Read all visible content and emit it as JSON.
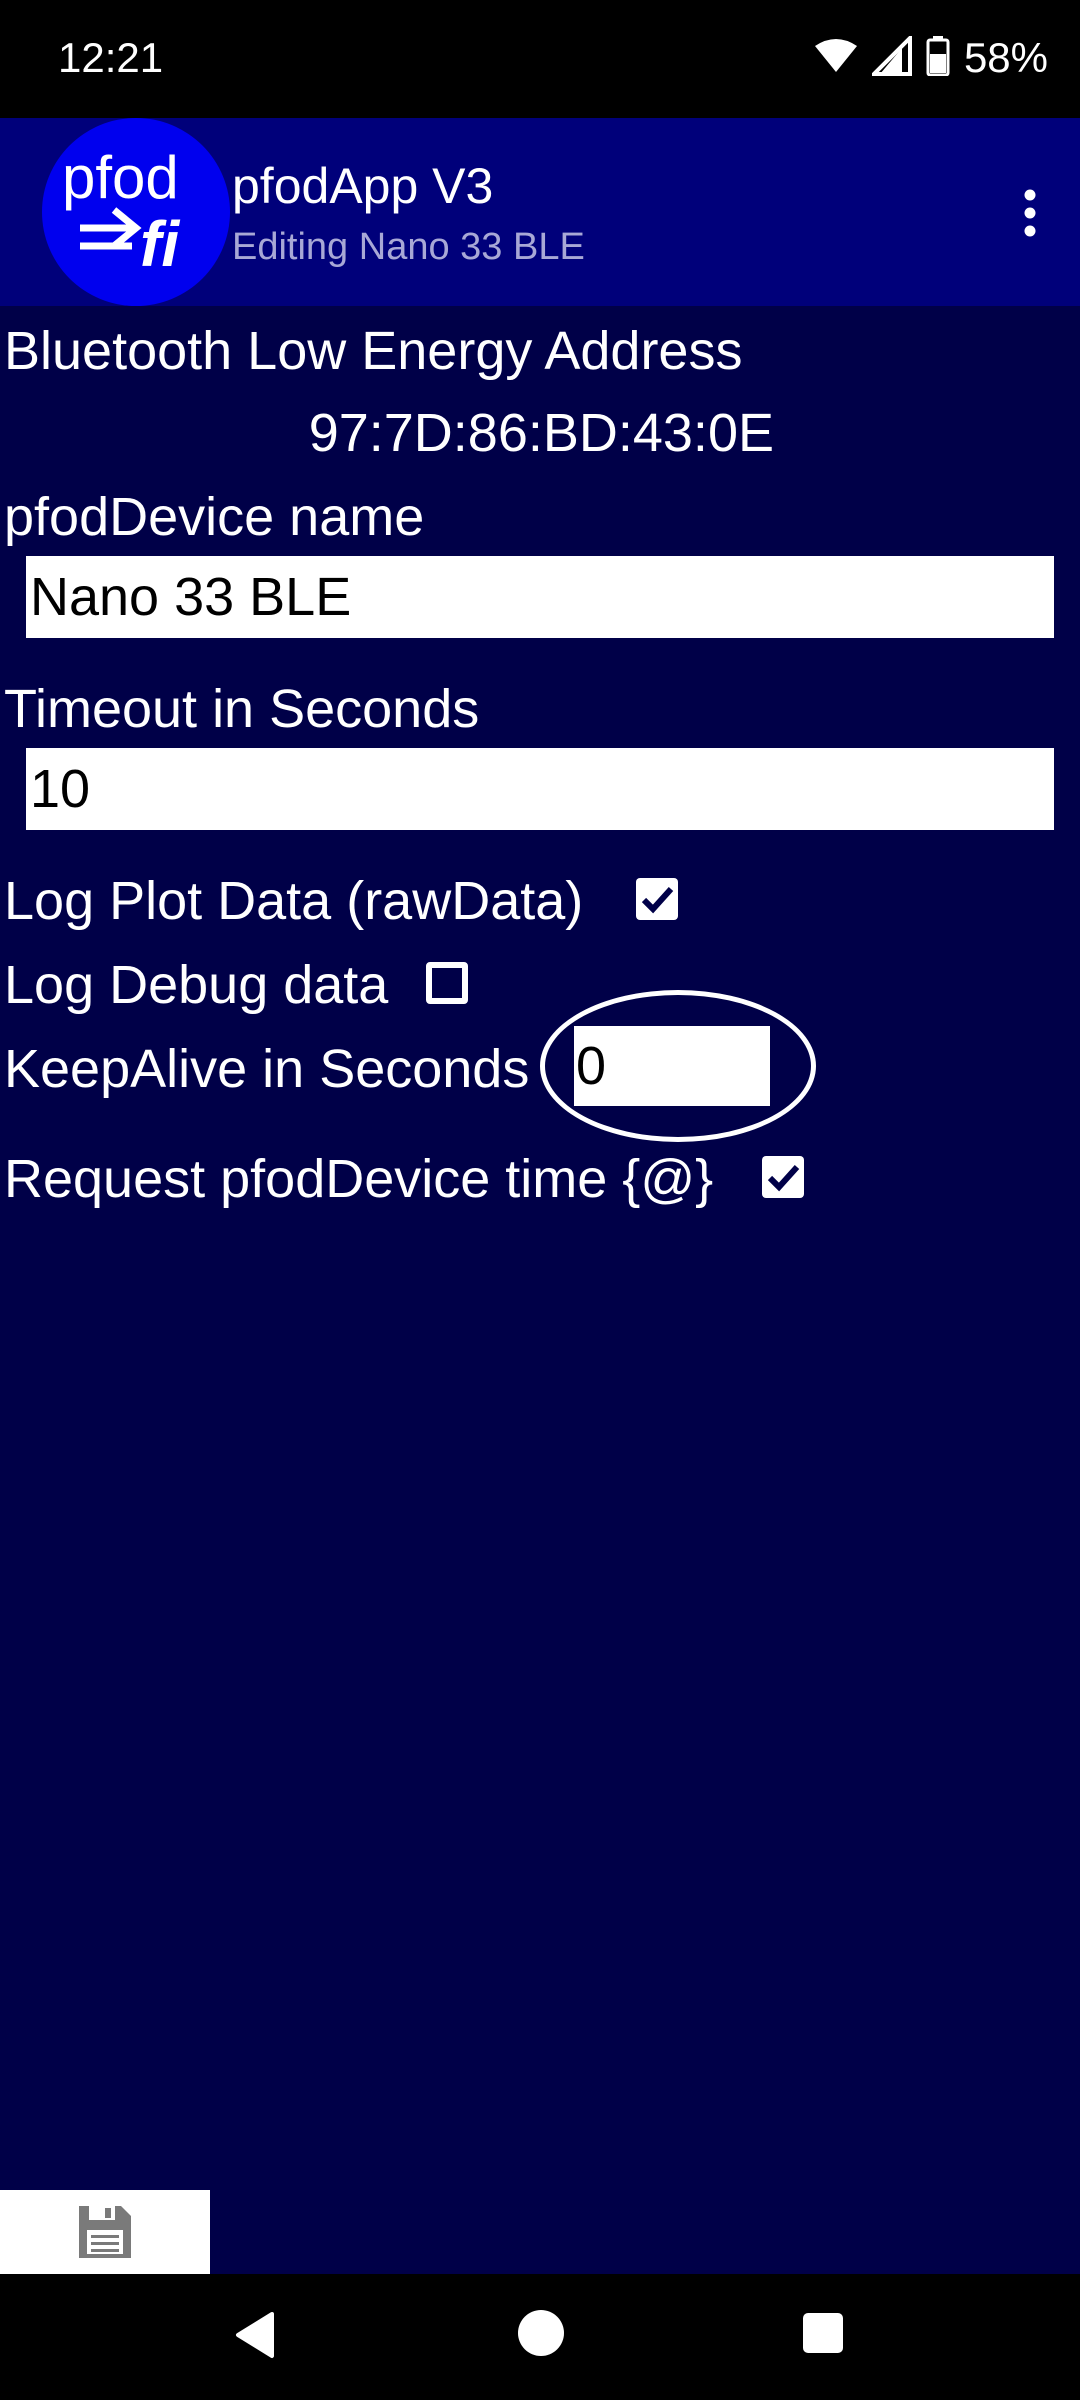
{
  "status_bar": {
    "time": "12:21",
    "battery_percent": "58%",
    "icons": [
      "wifi-icon",
      "cell-signal-icon",
      "battery-icon"
    ]
  },
  "app_bar": {
    "logo_text_top": "pfod",
    "logo_text_bottom": "fi",
    "title": "pfodApp V3",
    "subtitle": "Editing Nano 33 BLE"
  },
  "form": {
    "ble_address_label": "Bluetooth Low Energy Address",
    "ble_address_value": "97:7D:86:BD:43:0E",
    "device_name_label": "pfodDevice name",
    "device_name_value": "Nano 33 BLE",
    "timeout_label": "Timeout in Seconds",
    "timeout_value": "10",
    "log_plot_label": "Log Plot Data (rawData)",
    "log_plot_checked": true,
    "log_debug_label": "Log Debug data",
    "log_debug_checked": false,
    "keepalive_label": "KeepAlive in Seconds",
    "keepalive_value": "0",
    "request_time_label": "Request pfodDevice time {@}",
    "request_time_checked": true
  },
  "colors": {
    "background": "#000048",
    "app_bar": "#00007a",
    "logo_circle": "#0000ee",
    "subtitle": "#a8a8d6"
  }
}
